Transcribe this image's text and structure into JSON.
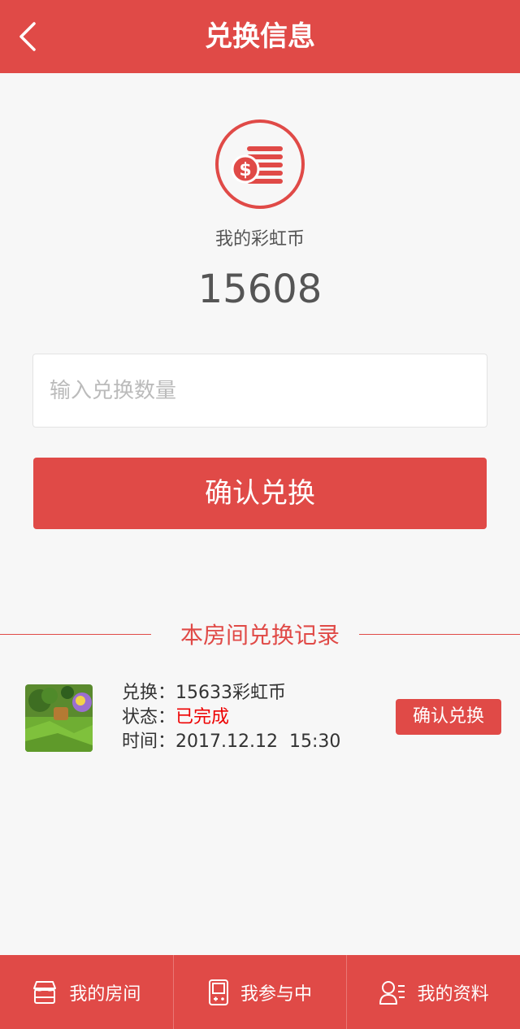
{
  "header": {
    "title": "兑换信息"
  },
  "wallet": {
    "label": "我的彩虹币",
    "value": "15608"
  },
  "exchange": {
    "placeholder": "输入兑换数量",
    "confirm_label": "确认兑换"
  },
  "records": {
    "section_title": "本房间兑换记录",
    "items": [
      {
        "exchange_label": "兑换：",
        "exchange_value": "15633彩虹币",
        "status_label": "状态：",
        "status_value": "已完成",
        "time_label": "时间：",
        "time_value": "2017.12.12  15:30",
        "button_label": "确认兑换"
      }
    ]
  },
  "tabbar": {
    "items": [
      {
        "label": "我的房间",
        "icon": "store-icon"
      },
      {
        "label": "我参与中",
        "icon": "gameboy-icon"
      },
      {
        "label": "我的资料",
        "icon": "user-list-icon"
      }
    ]
  },
  "colors": {
    "accent": "#e04a47",
    "status_done": "#e00000",
    "background": "#f7f7f7"
  }
}
